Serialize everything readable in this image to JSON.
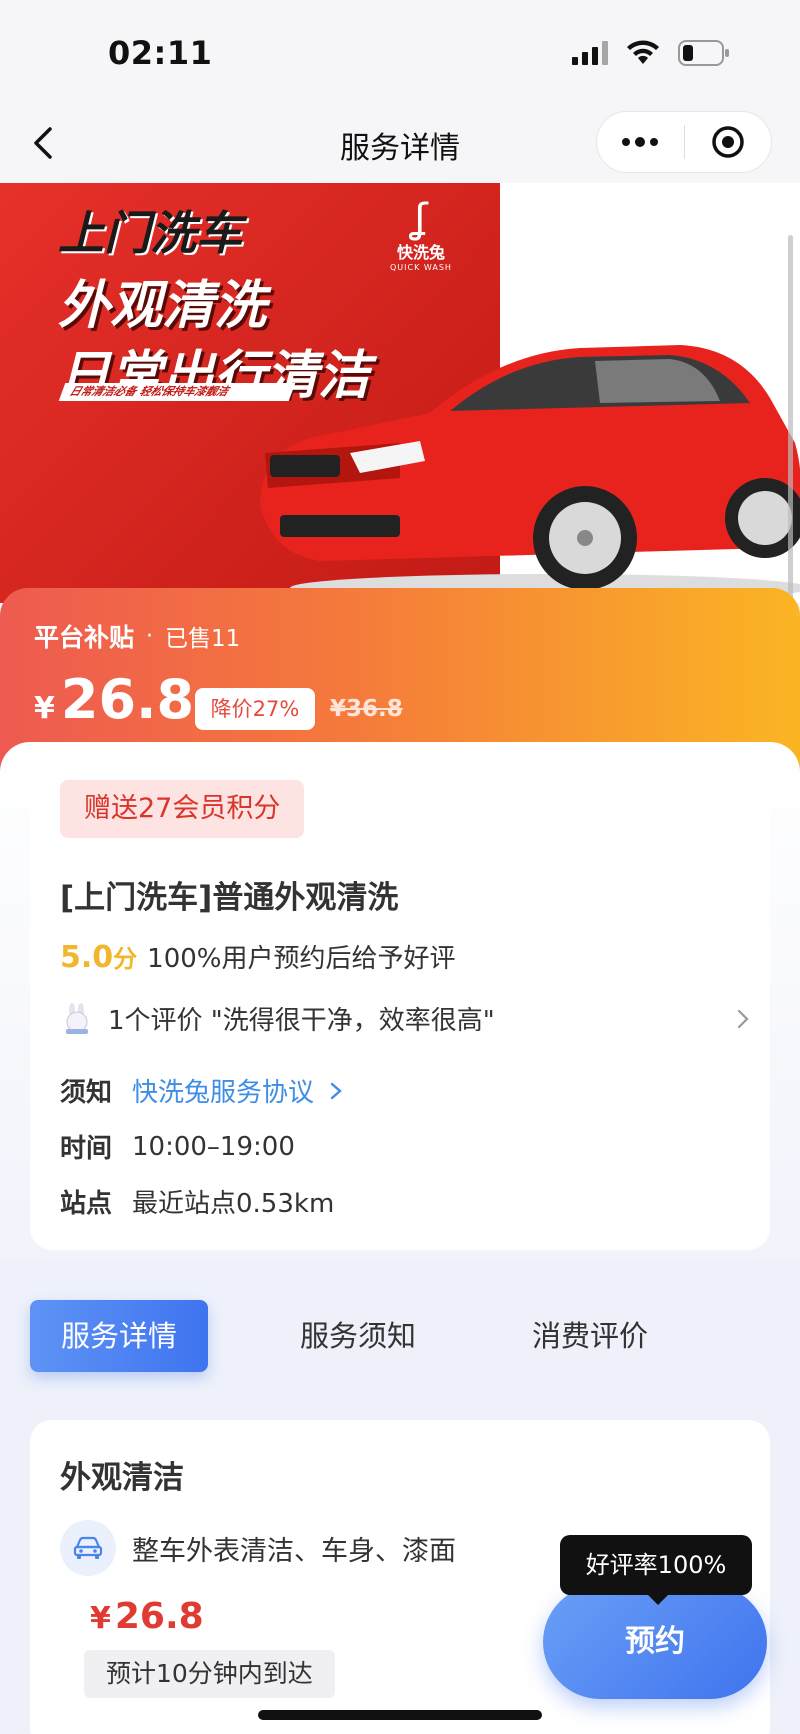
{
  "status_bar": {
    "time": "02:11"
  },
  "nav": {
    "title": "服务详情"
  },
  "banner": {
    "line1": "上门洗车",
    "line2": "外观清洗",
    "line3": "日常出行清洁",
    "subline": "日常清洁必备 轻松保持车漆靓洁",
    "brand_cn": "快洗兔",
    "brand_en": "QUICK WASH"
  },
  "promo": {
    "tag": "平台补贴",
    "dot": "·",
    "sold": "已售11",
    "currency": "¥",
    "price": "26.8",
    "discount": "降价27%",
    "original_price": "¥36.8"
  },
  "info": {
    "points_badge": "赠送27会员积分",
    "title": "[上门洗车]普通外观清洗",
    "score": "5.0",
    "score_unit": "分",
    "rating_text": "100%用户预约后给予好评",
    "review_text": "1个评价 \"洗得很干净，效率很高\"",
    "notice_key": "须知",
    "notice_value": "快洗兔服务协议",
    "time_key": "时间",
    "time_value": "10:00–19:00",
    "site_key": "站点",
    "site_value": "最近站点0.53km"
  },
  "tabs": [
    {
      "label": "服务详情"
    },
    {
      "label": "服务须知"
    },
    {
      "label": "消费评价"
    }
  ],
  "detail": {
    "title": "外观清洁",
    "item": "整车外表清洁、车身、漆面",
    "currency": "¥",
    "price": "26.8",
    "eta": "预计10分钟内到达"
  },
  "booking": {
    "tooltip": "好评率100%",
    "button": "预约"
  },
  "colors": {
    "accent_blue": "#3f74f0",
    "price_red": "#e03b32",
    "score_yellow": "#f2b62c",
    "link_blue": "#3e8de6"
  }
}
